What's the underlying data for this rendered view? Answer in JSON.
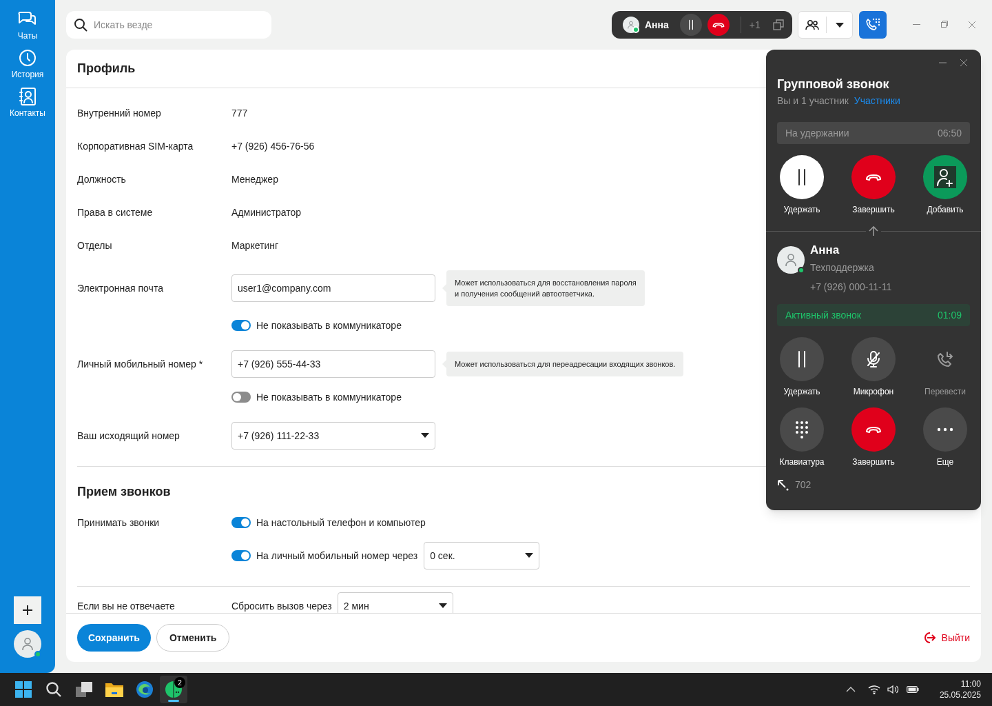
{
  "sidebar": {
    "items": [
      {
        "kind": "chats",
        "label": "Чаты"
      },
      {
        "kind": "history",
        "label": "История"
      },
      {
        "kind": "contacts",
        "label": "Контакты"
      }
    ],
    "user_online": true
  },
  "search": {
    "placeholder": "Искать везде"
  },
  "call_bar": {
    "name": "Анна",
    "online": true,
    "extra": "+1"
  },
  "profile": {
    "title": "Профиль",
    "fields": [
      {
        "label": "Внутренний номер",
        "value": "777"
      },
      {
        "label": "Корпоративная SIM-карта",
        "value": "+7 (926) 456-76-56"
      },
      {
        "label": "Должность",
        "value": "Менеджер"
      },
      {
        "label": "Права в системе",
        "value": "Администратор"
      },
      {
        "label": "Отделы",
        "value": "Маркетинг"
      }
    ],
    "contacts": [
      {
        "label": "Электронная почта",
        "value": "user1@company.com",
        "hint": "Может использоваться для восстановления пароля\nи получения сообщений автоответчика.",
        "toggle": {
          "label": "Не показывать в коммуникаторе",
          "on": true
        }
      },
      {
        "label": "Личный мобильный номер *",
        "value": "+7 (926) 555-44-33",
        "hint": "Может использоваться для переадресации входящих звонков.",
        "toggle": {
          "label": "Не показывать в коммуникаторе",
          "on": false
        }
      }
    ],
    "outgoing": {
      "label": "Ваш исходящий номер",
      "value": "+7 (926) 111-22-33"
    }
  },
  "calls": {
    "title": "Прием звонков",
    "label": "Принимать звонки",
    "options": [
      {
        "label": "На настольный телефон и компьютер",
        "on": true
      },
      {
        "label": "На личный мобильный номер через",
        "on": true,
        "delay": "0 сек."
      }
    ]
  },
  "no_answer": {
    "label": "Если вы не отвечаете",
    "action": "Сбросить вызов через",
    "value": "2 мин"
  },
  "footer": {
    "save": "Сохранить",
    "cancel": "Отменить",
    "logout": "Выйти"
  },
  "call_panel": {
    "title": "Групповой звонок",
    "subtitle": "Вы и 1 участник",
    "participants_link": "Участники",
    "held": {
      "status": "На удержании",
      "time": "06:50"
    },
    "held_actions": [
      {
        "kind": "hold",
        "label": "Удержать",
        "on": true,
        "disabled": false
      },
      {
        "kind": "end",
        "label": "Завершить",
        "disabled": false
      },
      {
        "kind": "add",
        "label": "Добавить",
        "disabled": false
      }
    ],
    "contact": {
      "name": "Анна",
      "department": "Техподдержка",
      "phone": "+7 (926) 000-11-11",
      "online": true
    },
    "active": {
      "status": "Активный звонок",
      "time": "01:09"
    },
    "actions": [
      {
        "kind": "hold",
        "label": "Удержать",
        "on": false,
        "disabled": false
      },
      {
        "kind": "mic",
        "label": "Микрофон",
        "on": false,
        "disabled": false
      },
      {
        "kind": "transfer",
        "label": "Перевести",
        "disabled": true
      },
      {
        "kind": "keypad",
        "label": "Клавиатура",
        "on": false,
        "disabled": false
      },
      {
        "kind": "end",
        "label": "Завершить",
        "disabled": false
      },
      {
        "kind": "more",
        "label": "Еще",
        "on": false,
        "disabled": false
      }
    ],
    "extension": "702"
  },
  "taskbar": {
    "badge": "2",
    "time": "11:00",
    "date": "25.05.2025"
  }
}
